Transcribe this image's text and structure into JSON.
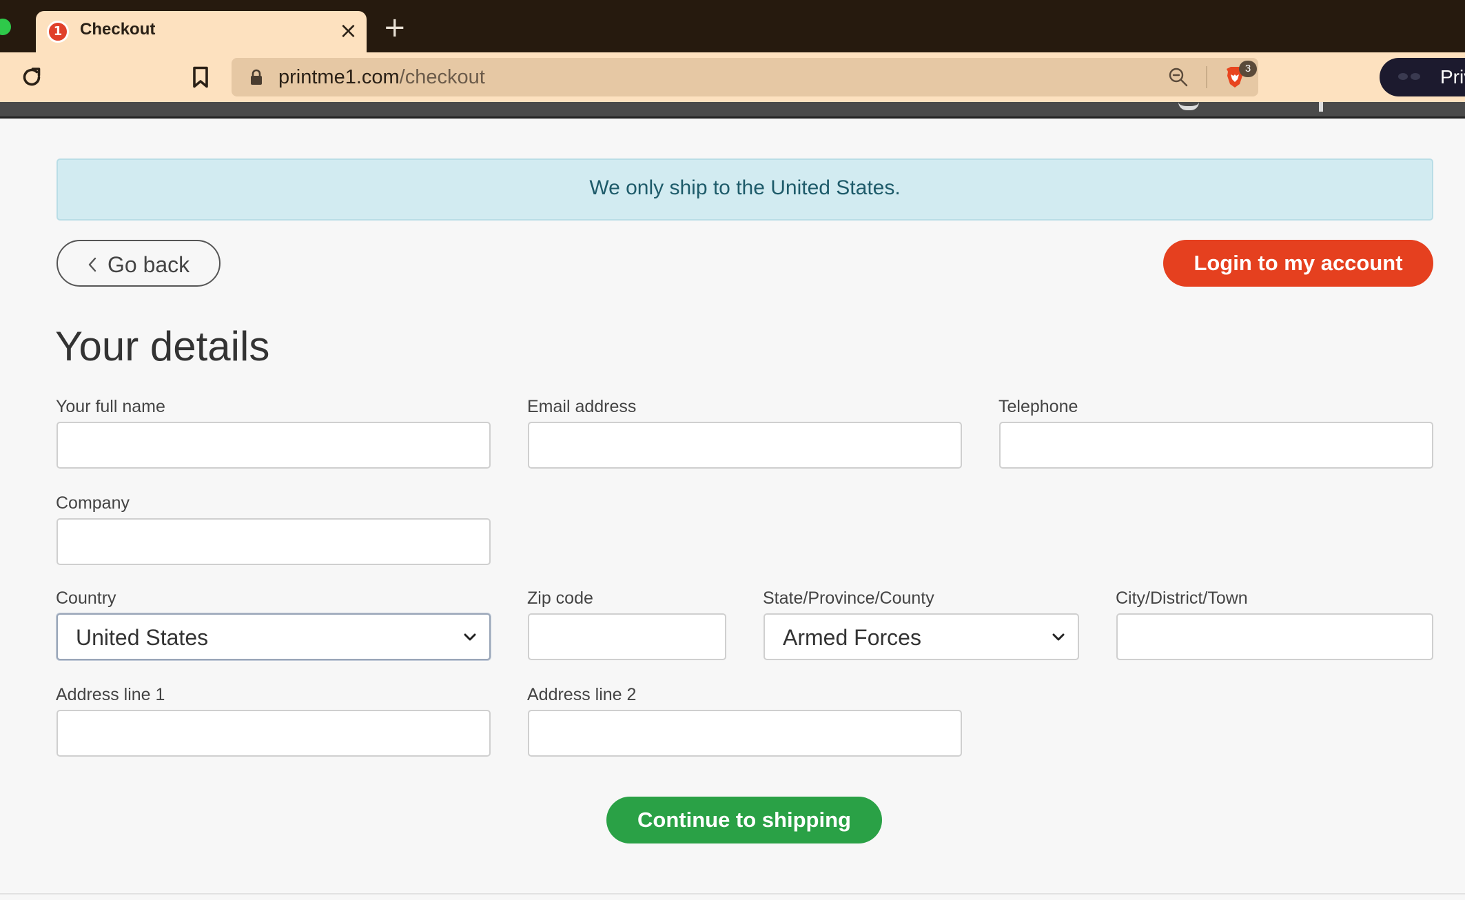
{
  "browser": {
    "tab": {
      "title": "Checkout",
      "favicon_text": "1",
      "close_glyph": "×"
    },
    "new_tab_glyph": "+",
    "address": {
      "host": "printme1.com",
      "path": "/checkout"
    },
    "shields_count": "3",
    "private_label": "Private"
  },
  "notice": {
    "text": "We only ship to the United States."
  },
  "actions": {
    "go_back": "Go back",
    "login": "Login to my account"
  },
  "form": {
    "title": "Your details",
    "full_name": {
      "label": "Your full name",
      "value": ""
    },
    "email": {
      "label": "Email address",
      "value": ""
    },
    "telephone": {
      "label": "Telephone",
      "value": ""
    },
    "company": {
      "label": "Company",
      "value": ""
    },
    "country": {
      "label": "Country",
      "value": "United States"
    },
    "zip": {
      "label": "Zip code",
      "value": ""
    },
    "state": {
      "label": "State/Province/County",
      "value": "Armed Forces"
    },
    "city": {
      "label": "City/District/Town",
      "value": ""
    },
    "address1": {
      "label": "Address line 1",
      "value": ""
    },
    "address2": {
      "label": "Address line 2",
      "value": ""
    },
    "submit": "Continue to shipping"
  },
  "colors": {
    "login_button": "#e5401f",
    "continue_button": "#2aa146",
    "notice_bg": "#d2ebf1",
    "tab_bg": "#fde1bf"
  }
}
